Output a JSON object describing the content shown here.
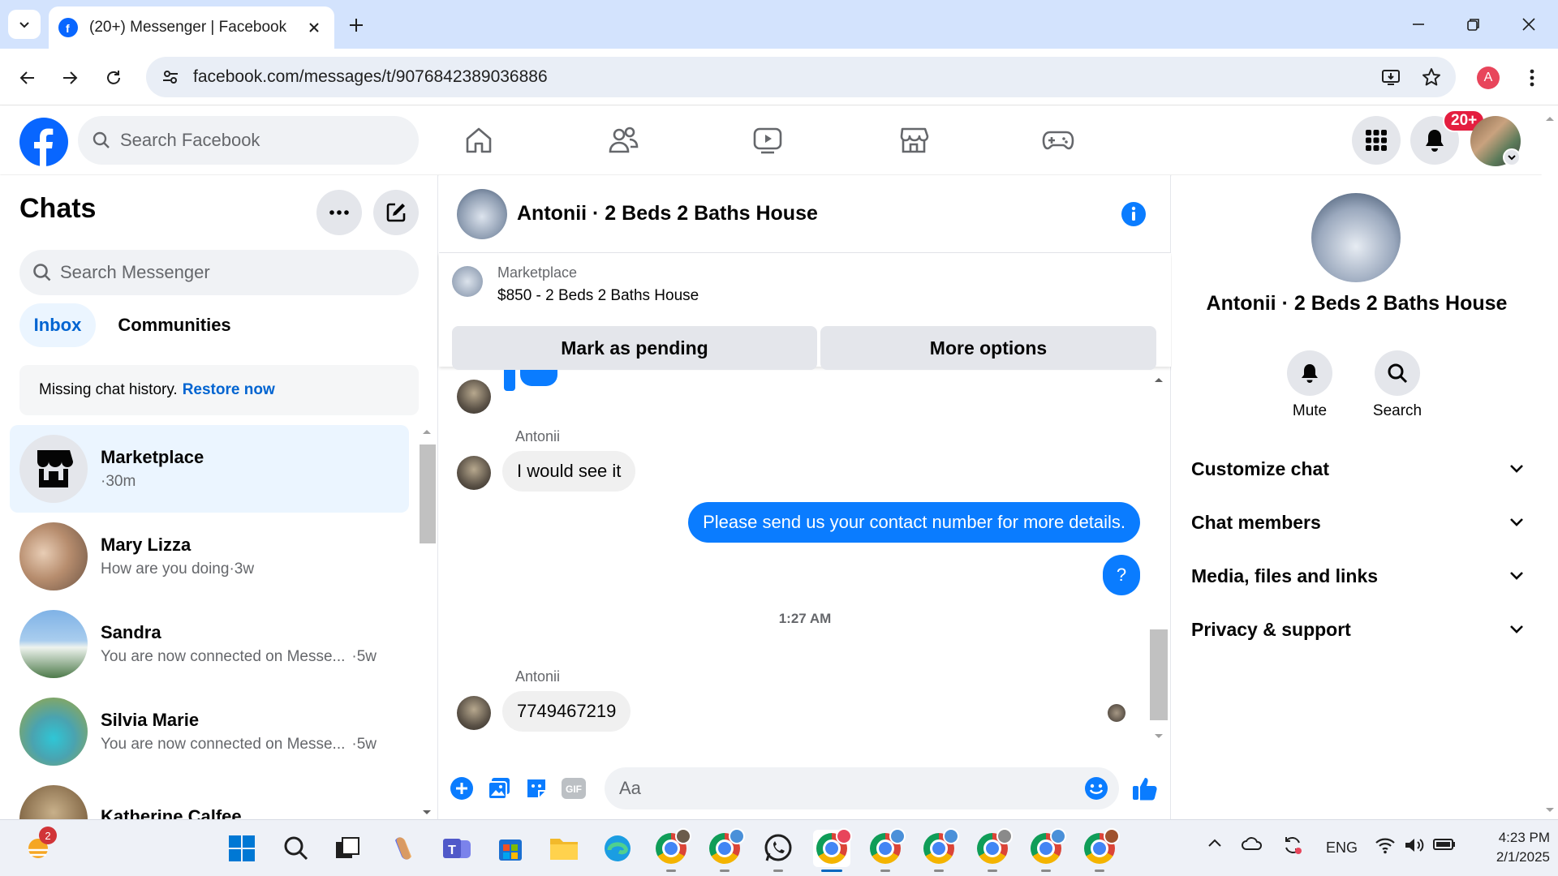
{
  "browser": {
    "tab_title": "(20+) Messenger | Facebook",
    "url": "facebook.com/messages/t/9076842389036886",
    "profile_initial": "A",
    "accent": "#d3e3fd"
  },
  "fb_header": {
    "search_placeholder": "Search Facebook",
    "notification_badge": "20+",
    "nav_icons": [
      "home-icon",
      "friends-icon",
      "video-icon",
      "marketplace-icon",
      "gaming-icon"
    ]
  },
  "chats": {
    "title": "Chats",
    "search_placeholder": "Search Messenger",
    "tabs": [
      "Inbox",
      "Communities"
    ],
    "missing_text": "Missing chat history.",
    "restore_link": "Restore now",
    "items": [
      {
        "name": "Marketplace",
        "preview": "",
        "time": "·30m"
      },
      {
        "name": "Mary Lizza",
        "preview": "How are you doing",
        "time": "·3w"
      },
      {
        "name": "Sandra",
        "preview": "You are now connected on Messe...",
        "time": "·5w"
      },
      {
        "name": "Silvia Marie",
        "preview": "You are now connected on Messe...",
        "time": "·5w"
      },
      {
        "name": "Katherine Calfee",
        "preview": "",
        "time": ""
      }
    ]
  },
  "conversation": {
    "title": "Antonii · 2 Beds 2 Baths House",
    "marketplace_label": "Marketplace",
    "listing": "$850 - 2 Beds 2 Baths House",
    "btn_pending": "Mark as pending",
    "btn_more": "More options",
    "messages": [
      {
        "sender": "Antonii",
        "text": "I would see it"
      },
      {
        "sender": "",
        "text": "Please send us your contact number for more details."
      },
      {
        "sender": "",
        "text": "?"
      },
      {
        "sender": "Antonii",
        "text": "7749467219"
      }
    ],
    "timestamp": "1:27 AM",
    "composer_placeholder": "Aa",
    "gif_label": "GIF"
  },
  "details": {
    "title": "Antonii · 2 Beds 2 Baths House",
    "mute": "Mute",
    "search": "Search",
    "sections": [
      "Customize chat",
      "Chat members",
      "Media, files and links",
      "Privacy & support"
    ]
  },
  "taskbar": {
    "weather_badge": "2",
    "lang": "ENG",
    "time": "4:23 PM",
    "date": "2/1/2025"
  }
}
